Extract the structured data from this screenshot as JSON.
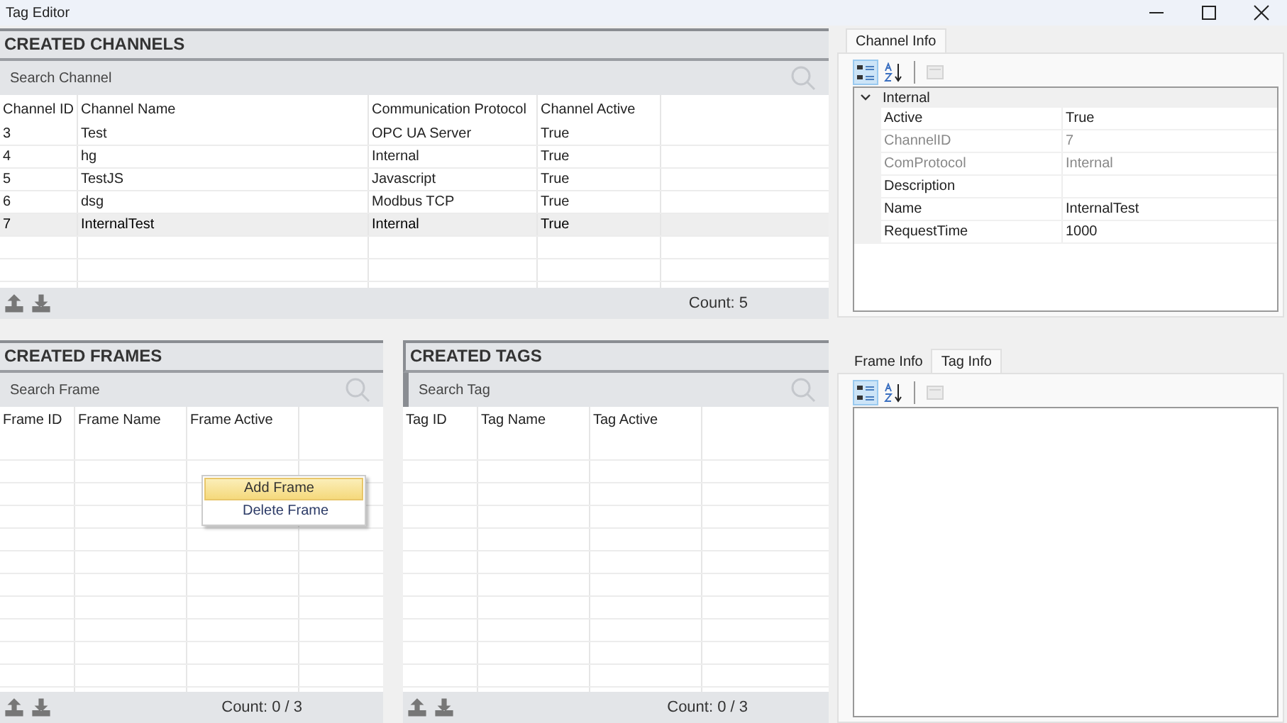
{
  "window": {
    "title": "Tag Editor"
  },
  "channels": {
    "title": "CREATED CHANNELS",
    "search": {
      "placeholder": "Search Channel"
    },
    "columns": [
      "Channel ID",
      "Channel Name",
      "Communication Protocol",
      "Channel Active"
    ],
    "rows": [
      {
        "cells": [
          "3",
          "Test",
          "OPC UA Server",
          "True"
        ],
        "selected": false
      },
      {
        "cells": [
          "4",
          "hg",
          "Internal",
          "True"
        ],
        "selected": false
      },
      {
        "cells": [
          "5",
          "TestJS",
          "Javascript",
          "True"
        ],
        "selected": false
      },
      {
        "cells": [
          "6",
          "dsg",
          "Modbus TCP",
          "True"
        ],
        "selected": false
      },
      {
        "cells": [
          "7",
          "InternalTest",
          "Internal",
          "True"
        ],
        "selected": true
      }
    ],
    "count": "Count: 5"
  },
  "frames": {
    "title": "CREATED FRAMES",
    "search": {
      "placeholder": "Search Frame"
    },
    "columns": [
      "Frame ID",
      "Frame Name",
      "Frame Active"
    ],
    "count": "Count: 0 / 3",
    "context_menu": [
      {
        "label": "Add Frame",
        "selected": true
      },
      {
        "label": "Delete Frame",
        "selected": false
      }
    ]
  },
  "tags": {
    "title": "CREATED TAGS",
    "search": {
      "placeholder": "Search Tag"
    },
    "columns": [
      "Tag ID",
      "Tag Name",
      "Tag Active"
    ],
    "count": "Count: 0 / 3"
  },
  "channel_info": {
    "tabs": [
      {
        "label": "Channel Info",
        "selected": true
      }
    ],
    "toolbar": [
      {
        "kind": "categorized",
        "selected": true,
        "disabled": false
      },
      {
        "kind": "alphabetical",
        "selected": false,
        "disabled": false
      },
      {
        "kind": "pages",
        "selected": false,
        "disabled": true
      }
    ],
    "category": {
      "label": "Internal",
      "expanded": true,
      "properties": [
        {
          "name": "Active",
          "value": "True",
          "readonly": false
        },
        {
          "name": "ChannelID",
          "value": "7",
          "readonly": true
        },
        {
          "name": "ComProtocol",
          "value": "Internal",
          "readonly": true
        },
        {
          "name": "Description",
          "readonly": false
        },
        {
          "name": "Name",
          "value": "InternalTest",
          "readonly": false
        },
        {
          "name": "RequestTime",
          "value": "1000",
          "readonly": false
        }
      ]
    }
  },
  "item_info": {
    "tabs": [
      {
        "label": "Frame Info",
        "selected": false
      },
      {
        "label": "Tag Info",
        "selected": true
      }
    ],
    "toolbar": [
      {
        "kind": "categorized",
        "selected": true,
        "disabled": false
      },
      {
        "kind": "alphabetical",
        "selected": false,
        "disabled": false
      },
      {
        "kind": "pages",
        "selected": false,
        "disabled": true
      }
    ]
  }
}
